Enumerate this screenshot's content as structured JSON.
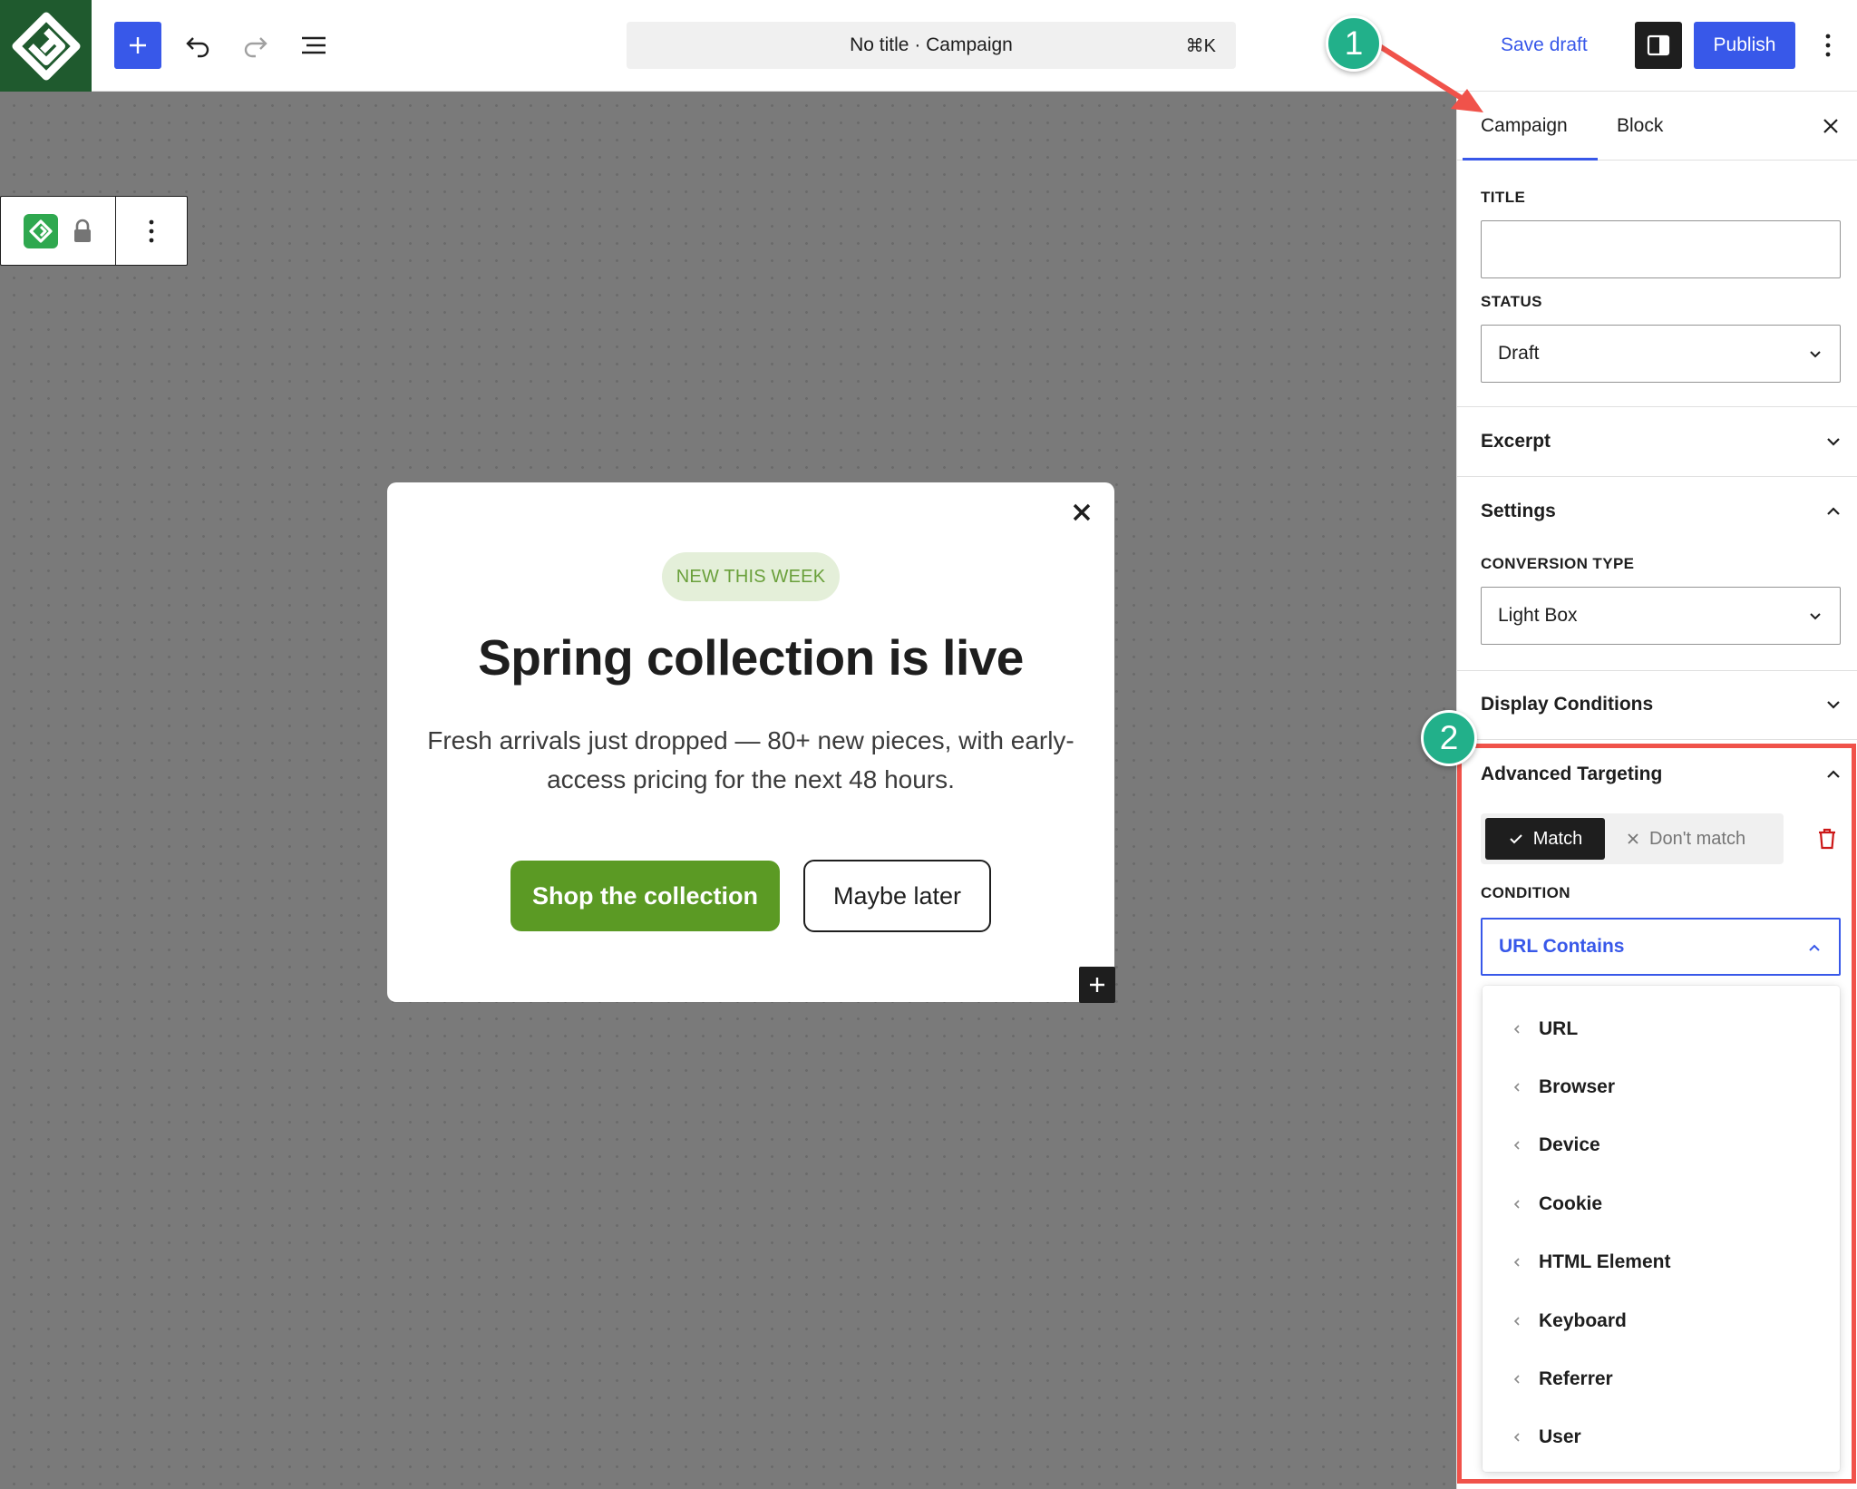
{
  "topbar": {
    "add_icon": "plus-icon",
    "undo_icon": "undo-icon",
    "redo_icon": "redo-icon",
    "list_view_icon": "list-view-icon",
    "document_title": "No title · Campaign",
    "shortcut": "⌘K",
    "save_draft_label": "Save draft",
    "settings_icon": "sidebar-toggle-icon",
    "publish_label": "Publish",
    "more_icon": "vertical-ellipsis-icon"
  },
  "block_toolbar": {
    "block_icon": "campaign-logo-icon",
    "lock_icon": "lock-icon",
    "options_icon": "vertical-ellipsis-icon"
  },
  "popup": {
    "badge": "NEW THIS WEEK",
    "headline": "Spring collection is live",
    "body": "Fresh arrivals just dropped — 80+ new pieces, with early-access pricing for the next 48 hours.",
    "primary_button": "Shop the collection",
    "secondary_button": "Maybe later",
    "primary_color": "#5b9a24",
    "badge_color": "#e4efd9"
  },
  "sidebar": {
    "tabs": [
      {
        "label": "Campaign",
        "active": true
      },
      {
        "label": "Block",
        "active": false
      }
    ],
    "title_label": "TITLE",
    "title_value": "",
    "status_label": "STATUS",
    "status_value": "Draft",
    "excerpt_panel": "Excerpt",
    "settings_panel": "Settings",
    "conversion_type_label": "CONVERSION TYPE",
    "conversion_type_value": "Light Box",
    "display_conditions_panel": "Display Conditions",
    "advanced_targeting_panel": "Advanced Targeting",
    "match_label": "Match",
    "dont_match_label": "Don't match",
    "condition_label": "CONDITION",
    "condition_value": "URL Contains",
    "condition_options": [
      "URL",
      "Browser",
      "Device",
      "Cookie",
      "HTML Element",
      "Keyboard",
      "Referrer",
      "User"
    ]
  },
  "annotations": {
    "marker_1": "1",
    "marker_2": "2",
    "highlight_color": "#f0524a",
    "marker_color": "#22b08a"
  },
  "colors": {
    "accent": "#3858e9",
    "canvas": "#7a7a7a",
    "delete": "#cc1818"
  }
}
